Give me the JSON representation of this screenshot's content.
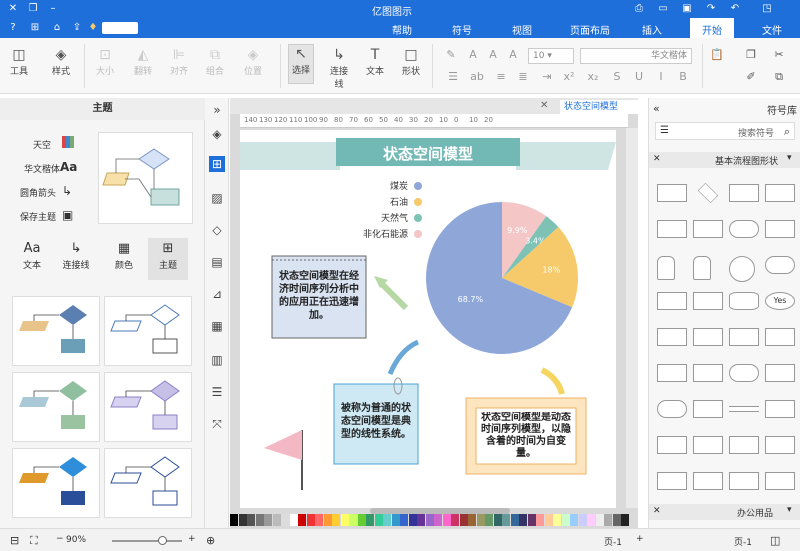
{
  "app": {
    "title": "亿图图示"
  },
  "menubar": {
    "items": [
      "文件",
      "开始",
      "插入",
      "页面布局",
      "视图",
      "符号",
      "帮助"
    ]
  },
  "ribbon": {
    "tools": [
      "工具",
      "样式",
      "大小",
      "翻转",
      "对齐",
      "组合",
      "位置",
      "选择",
      "连接线",
      "文本",
      "形状"
    ],
    "font_size": "10",
    "font_name": "华文楷体"
  },
  "library": {
    "title": "主题",
    "theme_options": [
      "天空",
      "华文楷体",
      "圆角箭头",
      "保存主题"
    ],
    "tools": [
      "文本",
      "连接线",
      "颜色",
      "主题"
    ]
  },
  "canvas": {
    "tab_label": "状态空间模型",
    "ruler_ticks": [
      "140",
      "130",
      "120",
      "110",
      "100",
      "90",
      "80",
      "70",
      "60",
      "50",
      "40",
      "30",
      "20",
      "10",
      "0",
      "10",
      "20"
    ],
    "diagram_title": "状态空间模型",
    "legend": [
      {
        "label": "煤炭",
        "color": "#8ea7d8"
      },
      {
        "label": "石油",
        "color": "#f6c96b"
      },
      {
        "label": "天然气",
        "color": "#7ec2b6"
      },
      {
        "label": "非化石能源",
        "color": "#f4c6c6"
      }
    ],
    "pie": {
      "slices": [
        {
          "label": "68.7%",
          "value": 68.7,
          "color": "#8ea7d8"
        },
        {
          "label": "18%",
          "value": 18.0,
          "color": "#f6c96b"
        },
        {
          "label": "3.4%",
          "value": 3.4,
          "color": "#7ec2b6"
        },
        {
          "label": "9.9%",
          "value": 9.9,
          "color": "#f4c6c6"
        }
      ]
    },
    "note1": "状态空间模型在经济时间序列分析中的应用正在迅速增加。",
    "note2": "被称为普通的状态空间模型是典型的线性系统。",
    "note3": "状态空间模型是动态时间序列模型，以隐含着的时间为自变量。"
  },
  "symbols": {
    "title": "符号库",
    "search_placeholder": "搜索符号",
    "category": "基本流程图形状",
    "category2": "办公用品",
    "yes_label": "Yes"
  },
  "status": {
    "page_label_left": "页-1",
    "page_label_right": "页-1",
    "zoom": "90%"
  }
}
